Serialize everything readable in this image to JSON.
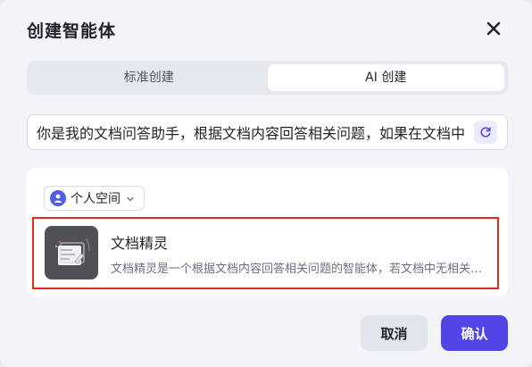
{
  "dialog": {
    "title": "创建智能体",
    "close_icon": "close-icon"
  },
  "tabs": [
    {
      "label": "标准创建",
      "active": false
    },
    {
      "label": "AI 创建",
      "active": true
    }
  ],
  "prompt": {
    "value": "你是我的文档问答助手，根据文档内容回答相关问题，如果在文档中找不到答案",
    "refresh_icon": "refresh-icon"
  },
  "space_selector": {
    "label": "个人空间",
    "avatar_icon": "user-icon",
    "chevron_icon": "chevron-down-icon"
  },
  "agent": {
    "name": "文档精灵",
    "description": "文档精灵是一个根据文档内容回答相关问题的智能体，若文档中无相关信息则会如实告知",
    "icon": "document-icon",
    "selected": true
  },
  "buttons": {
    "cancel": "取消",
    "confirm": "确认"
  },
  "colors": {
    "accent": "#5046e8",
    "selection_border": "#e02b1c",
    "background": "#f3f4f8"
  }
}
